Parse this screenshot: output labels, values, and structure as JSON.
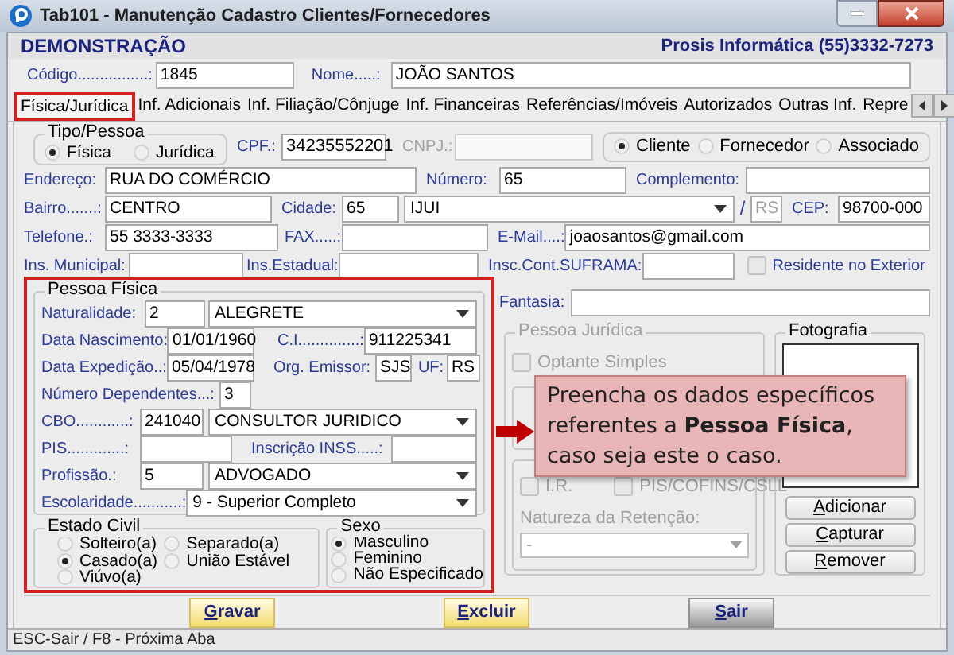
{
  "window": {
    "title": "Tab101 - Manutenção Cadastro Clientes/Fornecedores"
  },
  "header": {
    "company": "DEMONSTRAÇÃO",
    "contact": "Prosis Informática (55)3332-7273"
  },
  "top_fields": [
    {
      "label": "Código................:",
      "value": "1845"
    },
    {
      "label": "Nome.....:",
      "value": "JOÃO SANTOS"
    }
  ],
  "tabs": [
    {
      "label": "Física/Jurídica",
      "selected": true
    },
    {
      "label": "Inf. Adicionais",
      "selected": false
    },
    {
      "label": "Inf. Filiação/Cônjuge",
      "selected": false
    },
    {
      "label": "Inf. Financeiras",
      "selected": false
    },
    {
      "label": "Referências/Imóveis",
      "selected": false
    },
    {
      "label": "Autorizados",
      "selected": false
    },
    {
      "label": "Outras Inf.",
      "selected": false
    },
    {
      "label": "Repre",
      "selected": false
    }
  ],
  "tipo_pessoa": {
    "legend": "Tipo/Pessoa",
    "options": [
      {
        "label": "Física",
        "selected": true
      },
      {
        "label": "Jurídica",
        "selected": false
      }
    ]
  },
  "documents": [
    {
      "label": "CPF.:",
      "value": "34235552201",
      "disabled": false
    },
    {
      "label": "CNPJ.:",
      "disabled": true
    }
  ],
  "relation": [
    {
      "label": "Cliente",
      "selected": true
    },
    {
      "label": "Fornecedor",
      "selected": false
    },
    {
      "label": "Associado",
      "selected": false
    }
  ],
  "rows": [
    [
      {
        "kind": "label",
        "text": "Endereço:"
      },
      {
        "kind": "input",
        "value": "RUA DO COMÉRCIO"
      },
      {
        "kind": "label",
        "text": "Número:"
      },
      {
        "kind": "input",
        "value": "65"
      },
      {
        "kind": "label",
        "text": "Complemento:"
      },
      {
        "kind": "input"
      }
    ],
    [
      {
        "kind": "label",
        "text": "Bairro.......:"
      },
      {
        "kind": "input",
        "value": "CENTRO"
      },
      {
        "kind": "label",
        "text": "Cidade:"
      },
      {
        "kind": "input",
        "value": "65"
      },
      {
        "kind": "select",
        "value": "IJUI"
      },
      {
        "kind": "text",
        "text": "/"
      },
      {
        "kind": "input",
        "value": "RS",
        "disabled": true
      },
      {
        "kind": "label",
        "text": "CEP:"
      },
      {
        "kind": "input",
        "value": "98700-000"
      }
    ],
    [
      {
        "kind": "label",
        "text": "Telefone.:"
      },
      {
        "kind": "input",
        "value": "55 3333-3333"
      },
      {
        "kind": "label",
        "text": "FAX.....:"
      },
      {
        "kind": "input"
      },
      {
        "kind": "label",
        "text": "E-Mail....:"
      },
      {
        "kind": "input",
        "value": "joaosantos@gmail.com"
      }
    ],
    [
      {
        "kind": "label",
        "text": "Ins. Municipal:"
      },
      {
        "kind": "input"
      },
      {
        "kind": "label",
        "text": "Ins.Estadual:"
      },
      {
        "kind": "input"
      },
      {
        "kind": "label",
        "text": "Insc.Cont.SUFRAMA:"
      },
      {
        "kind": "input"
      },
      {
        "kind": "check",
        "label": "Residente no Exterior",
        "checked": false
      }
    ]
  ],
  "pessoa_fisica": {
    "legend": "Pessoa Física",
    "highlighted": true,
    "rows": [
      [
        {
          "kind": "label",
          "text": "Naturalidade:"
        },
        {
          "kind": "input",
          "value": "2"
        },
        {
          "kind": "select",
          "value": "ALEGRETE"
        }
      ],
      [
        {
          "kind": "label",
          "text": "Data Nascimento:"
        },
        {
          "kind": "input",
          "value": "01/01/1960"
        },
        {
          "kind": "label",
          "text": "C.I..............:"
        },
        {
          "kind": "input",
          "value": "911225341"
        }
      ],
      [
        {
          "kind": "label",
          "text": "Data Expedição..:"
        },
        {
          "kind": "input",
          "value": "05/04/1978"
        },
        {
          "kind": "label",
          "text": "Org. Emissor:"
        },
        {
          "kind": "input",
          "value": "SJS"
        },
        {
          "kind": "label",
          "text": "UF:"
        },
        {
          "kind": "input",
          "value": "RS"
        }
      ],
      [
        {
          "kind": "label",
          "text": "Número Dependentes...:"
        },
        {
          "kind": "input",
          "value": "3"
        }
      ],
      [
        {
          "kind": "label",
          "text": "CBO............:"
        },
        {
          "kind": "input",
          "value": "241040"
        },
        {
          "kind": "select",
          "value": "CONSULTOR JURIDICO"
        }
      ],
      [
        {
          "kind": "label",
          "text": "PIS.............:"
        },
        {
          "kind": "input"
        },
        {
          "kind": "label",
          "text": "Inscrição INSS.....:"
        },
        {
          "kind": "input"
        }
      ],
      [
        {
          "kind": "label",
          "text": "Profissão.:"
        },
        {
          "kind": "input",
          "value": "5"
        },
        {
          "kind": "select",
          "value": "ADVOGADO"
        }
      ],
      [
        {
          "kind": "label",
          "text": "Escolaridade...........:"
        },
        {
          "kind": "select",
          "value": "9 - Superior Completo"
        }
      ]
    ]
  },
  "estado_civil": {
    "legend": "Estado Civil",
    "options": [
      {
        "label": "Solteiro(a)",
        "selected": false
      },
      {
        "label": "Casado(a)",
        "selected": true
      },
      {
        "label": "Viúvo(a)",
        "selected": false
      },
      {
        "label": "Separado(a)",
        "selected": false
      },
      {
        "label": "União Estável",
        "selected": false
      }
    ]
  },
  "sexo": {
    "legend": "Sexo",
    "options": [
      {
        "label": "Masculino",
        "selected": true
      },
      {
        "label": "Feminino",
        "selected": false
      },
      {
        "label": "Não Especificado",
        "selected": false
      }
    ]
  },
  "fantasia": {
    "label": "Fantasia:"
  },
  "pessoa_juridica": {
    "legend": "Pessoa Jurídica",
    "disabled": true,
    "optante": {
      "label": "Optante Simples",
      "checked": false
    },
    "retencao": [
      {
        "label": "I.R.",
        "checked": false
      },
      {
        "label": "PIS/COFINS/CSLL",
        "checked": false
      }
    ],
    "natureza_label": "Natureza da Retenção:",
    "natureza_value": "-"
  },
  "fotografia": {
    "legend": "Fotografia",
    "buttons": [
      "Adicionar",
      "Capturar",
      "Remover"
    ]
  },
  "callout": "Preencha os dados específicos referentes  a **Pessoa Física**, caso seja este o caso.",
  "actions": [
    {
      "label": "Gravar",
      "kind": "primary"
    },
    {
      "label": "Excluir",
      "kind": "primary"
    },
    {
      "label": "Sair",
      "kind": "neutral"
    }
  ],
  "status_bar": "ESC-Sair / F8 - Próxima Aba"
}
